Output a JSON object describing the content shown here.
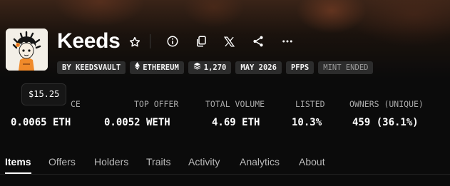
{
  "collection": {
    "name": "Keeds"
  },
  "header_icons": [
    {
      "name": "star-icon"
    },
    {
      "name": "info-icon"
    },
    {
      "name": "copy-icon"
    },
    {
      "name": "x-logo-icon"
    },
    {
      "name": "share-icon"
    },
    {
      "name": "more-icon"
    }
  ],
  "badges": {
    "creator": "BY KEEDSVAULT",
    "chain": "ETHEREUM",
    "items": "1,270",
    "date": "MAY 2026",
    "category": "PFPS",
    "status": "MINT ENDED"
  },
  "tooltip": {
    "value": "$15.25"
  },
  "stats": [
    {
      "label": "CE",
      "value": "0.0065 ETH"
    },
    {
      "label": "TOP OFFER",
      "value": "0.0052 WETH"
    },
    {
      "label": "TOTAL VOLUME",
      "value": "4.69 ETH"
    },
    {
      "label": "LISTED",
      "value": "10.3%"
    },
    {
      "label": "OWNERS (UNIQUE)",
      "value": "459 (36.1%)"
    }
  ],
  "tabs": [
    {
      "label": "Items",
      "active": true
    },
    {
      "label": "Offers"
    },
    {
      "label": "Holders"
    },
    {
      "label": "Traits"
    },
    {
      "label": "Activity"
    },
    {
      "label": "Analytics"
    },
    {
      "label": "About"
    }
  ]
}
